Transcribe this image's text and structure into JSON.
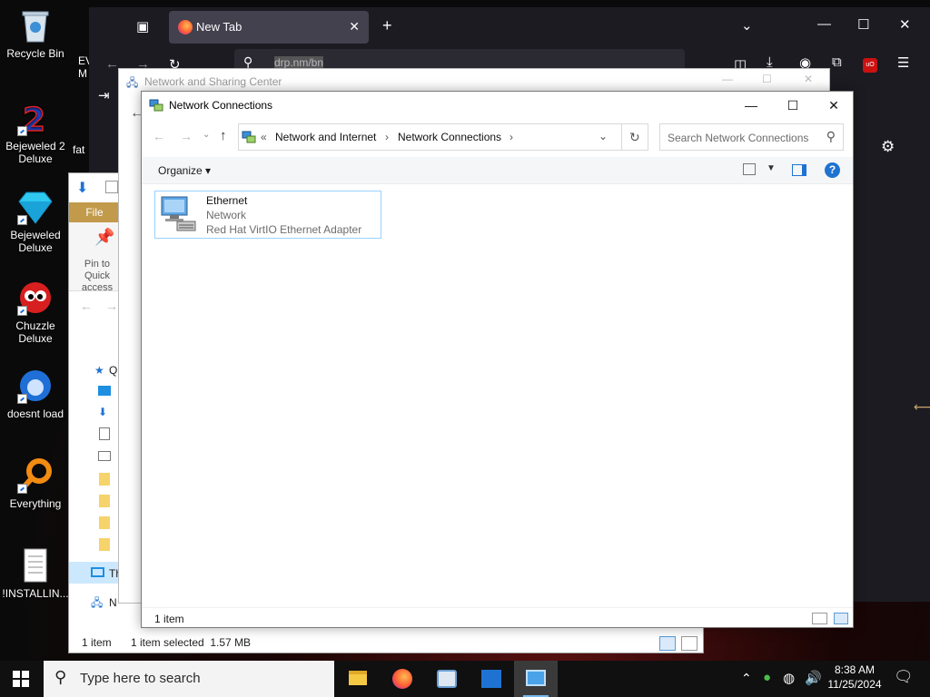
{
  "desktop": {
    "icons": [
      {
        "label": "Recycle Bin"
      },
      {
        "label": "Bejeweled 2 Deluxe"
      },
      {
        "label": "Bejeweled Deluxe"
      },
      {
        "label": "Chuzzle Deluxe"
      },
      {
        "label": "doesnt load"
      },
      {
        "label": "Everything"
      },
      {
        "label": "!INSTALLIN..."
      }
    ],
    "partial_labels": [
      "EV",
      "M",
      "fat"
    ]
  },
  "browser": {
    "tab_title": "New Tab",
    "url_text": "drp.nm/bn",
    "ublock_badge": "uO"
  },
  "explorer": {
    "file_tab": "File",
    "pin_label": "Pin to Quick access",
    "sidebar_q": "Q",
    "sidebar_th": "Th",
    "sidebar_n": "N",
    "status_items": "1 item",
    "status_selected": "1 item selected  1.57 MB"
  },
  "nsc": {
    "title": "Network and Sharing Center"
  },
  "nc": {
    "title": "Network Connections",
    "breadcrumb": {
      "overflow": "«",
      "part1": "Network and Internet",
      "part2": "Network Connections"
    },
    "search_placeholder": "Search Network Connections",
    "organize": "Organize",
    "help": "?",
    "item": {
      "name": "Ethernet",
      "status": "Network",
      "adapter": "Red Hat VirtIO Ethernet Adapter"
    },
    "status_count": "1 item"
  },
  "taskbar": {
    "search_placeholder": "Type here to search",
    "time": "8:38 AM",
    "date": "11/25/2024"
  },
  "colors": {
    "accent": "#0078d7",
    "selection_border": "#99d1ff",
    "browser_bg": "#1c1b22"
  }
}
